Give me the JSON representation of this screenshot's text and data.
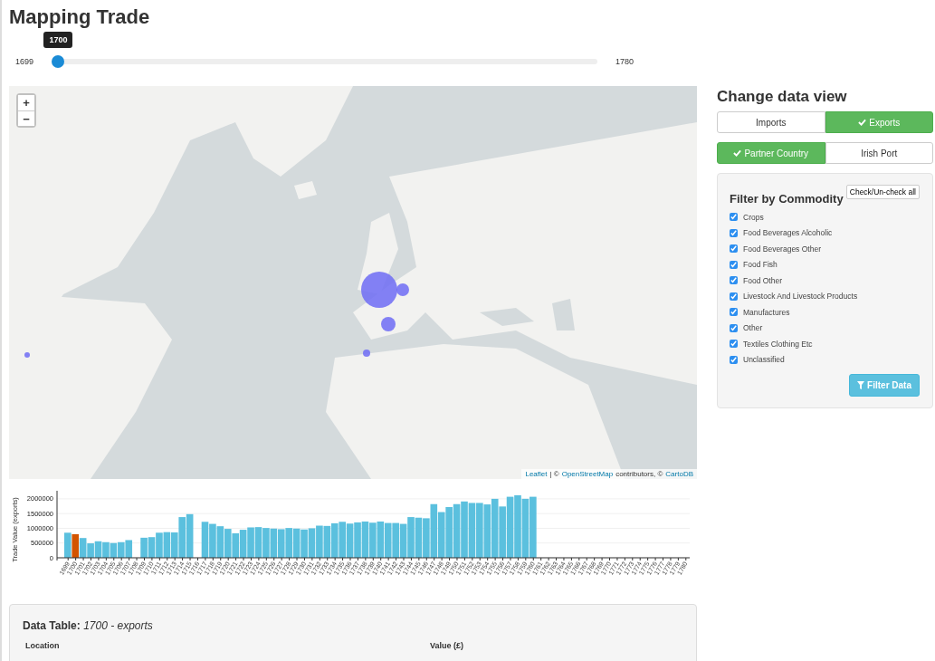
{
  "title": "Mapping Trade",
  "year_slider": {
    "min_label": "1699",
    "max_label": "1780",
    "value_label": "1700",
    "level": 0.0123
  },
  "map": {
    "zoom_in": "+",
    "zoom_out": "−",
    "attribution": [
      {
        "text": "Leaflet",
        "link": true
      },
      {
        "text": "| ©",
        "link": false
      },
      {
        "text": "OpenStreetMap",
        "link": true
      },
      {
        "text": "contributors, ©",
        "link": false
      },
      {
        "text": "CartoDB",
        "link": true
      }
    ]
  },
  "chart_data": {
    "type": "bar",
    "ylabel": "Trade Value (exports)",
    "categories": [
      "1699",
      "1700",
      "1701",
      "1702",
      "1703",
      "1704",
      "1705",
      "1706",
      "1707",
      "1708",
      "1709",
      "1710",
      "1711",
      "1712",
      "1713",
      "1714",
      "1715",
      "1716",
      "1717",
      "1718",
      "1719",
      "1720",
      "1721",
      "1722",
      "1723",
      "1724",
      "1725",
      "1726",
      "1727",
      "1728",
      "1729",
      "1730",
      "1731",
      "1732",
      "1733",
      "1734",
      "1735",
      "1736",
      "1737",
      "1738",
      "1739",
      "1740",
      "1741",
      "1742",
      "1743",
      "1744",
      "1745",
      "1746",
      "1747",
      "1748",
      "1749",
      "1750",
      "1751",
      "1752",
      "1753",
      "1754",
      "1755",
      "1756",
      "1757",
      "1758",
      "1759",
      "1760",
      "1761",
      "1762",
      "1763",
      "1764",
      "1765",
      "1766",
      "1767",
      "1768",
      "1769",
      "1770",
      "1771",
      "1772",
      "1773",
      "1774",
      "1775",
      "1776",
      "1777",
      "1778",
      "1779",
      "1780"
    ],
    "stacked": true,
    "grid": true,
    "series": [
      {
        "color": "#d35400",
        "values": [
          null,
          800000,
          null,
          null,
          null,
          null,
          null,
          null,
          null,
          null,
          null,
          null,
          null,
          null,
          null,
          null,
          null,
          null,
          null,
          null,
          null,
          null,
          null,
          null,
          null,
          null,
          null,
          null,
          null,
          null,
          null,
          null,
          null,
          null,
          null,
          null,
          null,
          null,
          null,
          null,
          null,
          null,
          null,
          null,
          null,
          null,
          null,
          null,
          null,
          null,
          null,
          null,
          null,
          null,
          null,
          null,
          null,
          null,
          null,
          null,
          null,
          null,
          null,
          null,
          null,
          null,
          null,
          null,
          null,
          null,
          null,
          null,
          null,
          null,
          null,
          null,
          null,
          null,
          null,
          null,
          null,
          null
        ]
      },
      {
        "color": "#5bc0de",
        "values": [
          850000,
          null,
          670000,
          490000,
          560000,
          530000,
          500000,
          530000,
          600000,
          null,
          680000,
          700000,
          850000,
          870000,
          860000,
          1380000,
          1480000,
          null,
          1220000,
          1150000,
          1070000,
          980000,
          830000,
          950000,
          1030000,
          1040000,
          1010000,
          990000,
          970000,
          1010000,
          990000,
          960000,
          1000000,
          1090000,
          1080000,
          1170000,
          1220000,
          1160000,
          1200000,
          1230000,
          1190000,
          1230000,
          1180000,
          1180000,
          1150000,
          1380000,
          1360000,
          1340000,
          1820000,
          1550000,
          1720000,
          1820000,
          1910000,
          1860000,
          1860000,
          1810000,
          2000000,
          1740000,
          2070000,
          2120000,
          2000000,
          2070000,
          null,
          null,
          null,
          null,
          null,
          null,
          null,
          null,
          null,
          null,
          null,
          null,
          null,
          null,
          null,
          null,
          null,
          null,
          null,
          null
        ]
      }
    ],
    "ylim": [
      0,
      2150000
    ],
    "yticks": [
      {
        "value": 0,
        "label": "0"
      },
      {
        "value": 500000,
        "label": "500000"
      },
      {
        "value": 1000000,
        "label": "1000000"
      },
      {
        "value": 1500000,
        "label": "1500000"
      },
      {
        "value": 2000000,
        "label": "2000000"
      }
    ],
    "orientation": "vertical"
  },
  "change_view": {
    "heading": "Change data view",
    "flow_toggle": [
      {
        "label": "Imports",
        "selected": false
      },
      {
        "label": "Exports",
        "selected": true
      }
    ],
    "grouping_toggle": [
      {
        "label": "Partner Country",
        "selected": true
      },
      {
        "label": "Irish Port",
        "selected": false
      }
    ]
  },
  "filter": {
    "heading": "Filter by Commodity",
    "check_all": "Check/Un-check all",
    "commodities": [
      {
        "label": "Crops",
        "checked": true
      },
      {
        "label": "Food Beverages Alcoholic",
        "checked": true
      },
      {
        "label": "Food Beverages Other",
        "checked": true
      },
      {
        "label": "Food Fish",
        "checked": true
      },
      {
        "label": "Food Other",
        "checked": true
      },
      {
        "label": "Livestock And Livestock Products",
        "checked": true
      },
      {
        "label": "Manufactures",
        "checked": true
      },
      {
        "label": "Other",
        "checked": true
      },
      {
        "label": "Textiles Clothing Etc",
        "checked": true
      },
      {
        "label": "Unclassified",
        "checked": true
      }
    ],
    "button": "Filter Data"
  },
  "data_table": {
    "heading": "**Data Table:** *1700 - exports*",
    "columns": [
      "Location",
      "Value (£)"
    ]
  }
}
